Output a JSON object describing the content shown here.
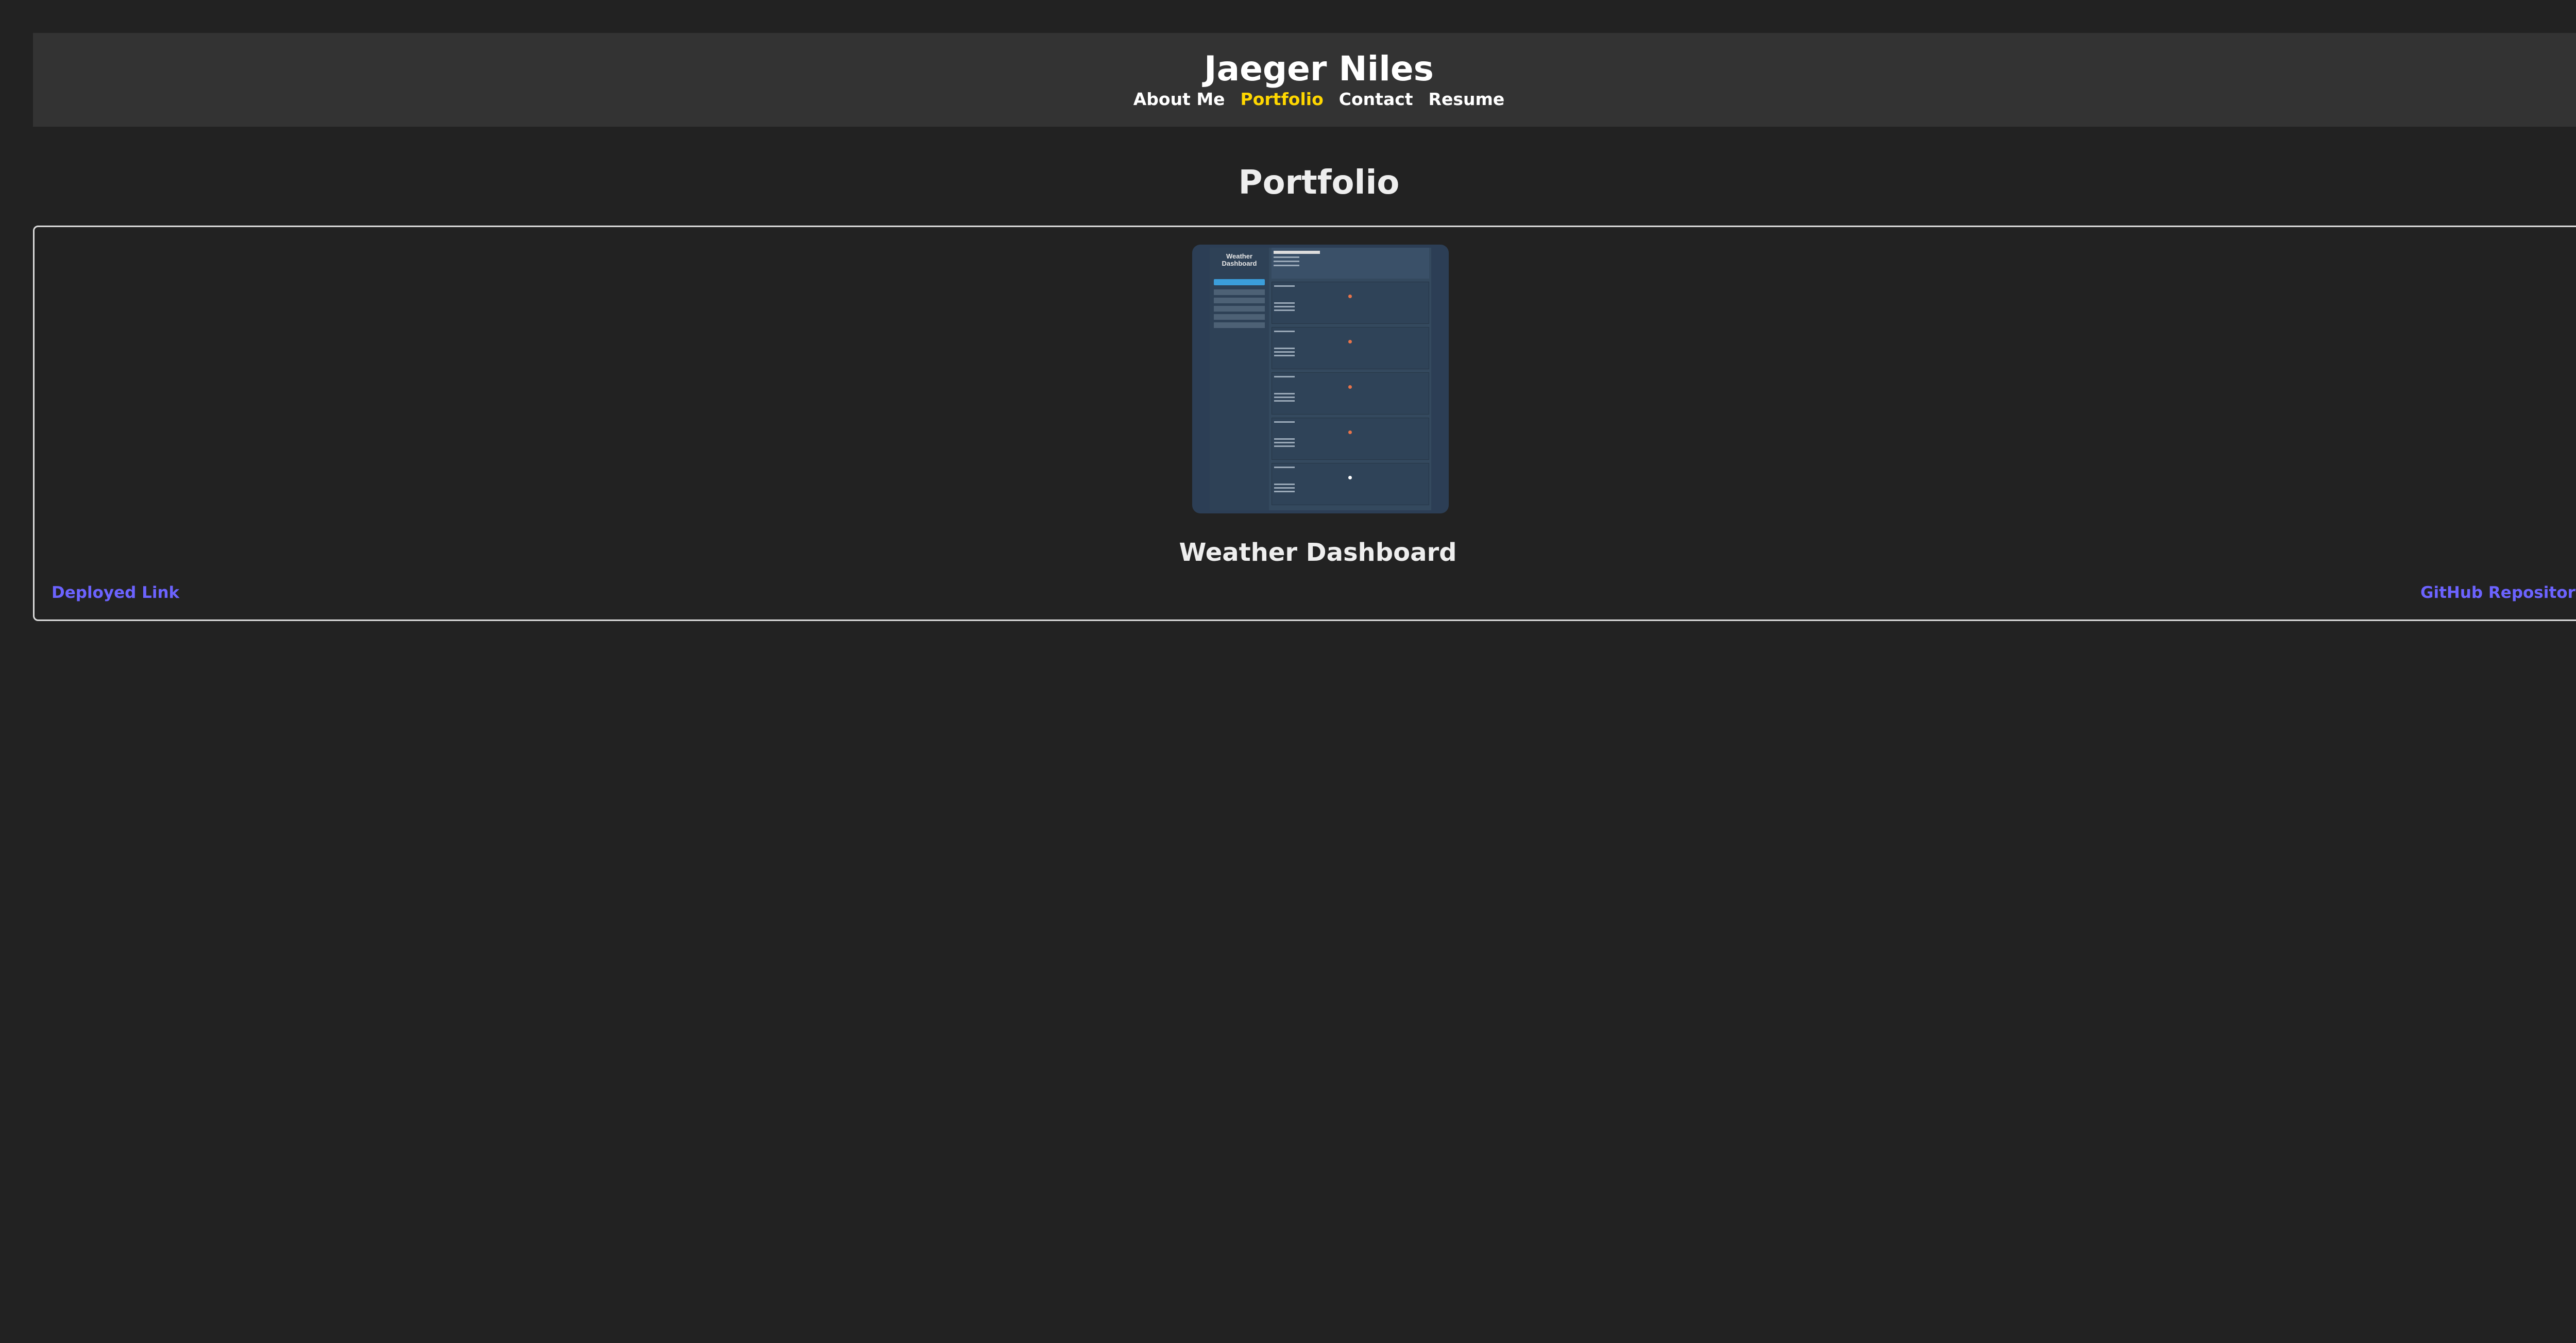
{
  "header": {
    "title": "Jaeger Niles",
    "nav": [
      {
        "label": "About Me",
        "active": false
      },
      {
        "label": "Portfolio",
        "active": true
      },
      {
        "label": "Contact",
        "active": false
      },
      {
        "label": "Resume",
        "active": false
      }
    ]
  },
  "section": {
    "title": "Portfolio"
  },
  "project": {
    "name": "Weather Dashboard",
    "deployed_label": "Deployed Link",
    "repo_label": "GitHub Repository"
  },
  "colors": {
    "background": "#222222",
    "header_bg": "#333333",
    "active_nav": "#ffd700",
    "link": "#6c63ff"
  }
}
